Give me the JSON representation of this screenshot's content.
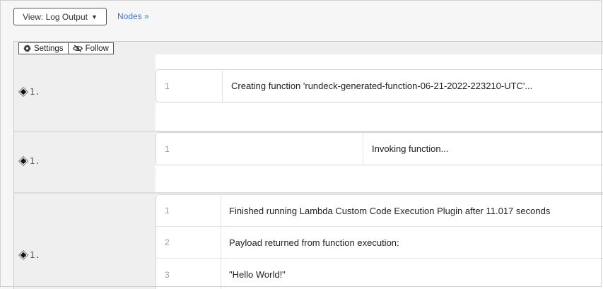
{
  "toolbar": {
    "view_label": "View: Log Output",
    "nodes_link": "Nodes »"
  },
  "log_toolbar": {
    "settings_label": "Settings",
    "follow_label": "Follow"
  },
  "groups": [
    {
      "node_label": "1.",
      "entries": [
        {
          "line": "1",
          "text": "Creating function 'rundeck-generated-function-06-21-2022-223210-UTC'..."
        }
      ]
    },
    {
      "node_label": "1.",
      "entries": [
        {
          "line": "1",
          "text": "Invoking function..."
        }
      ]
    },
    {
      "node_label": "1.",
      "entries": [
        {
          "line": "1",
          "text": "Finished running Lambda Custom Code Execution Plugin after 11.017 seconds"
        },
        {
          "line": "2",
          "text": "Payload returned from function execution:"
        },
        {
          "line": "3",
          "text": "\"Hello World!\""
        }
      ]
    }
  ]
}
